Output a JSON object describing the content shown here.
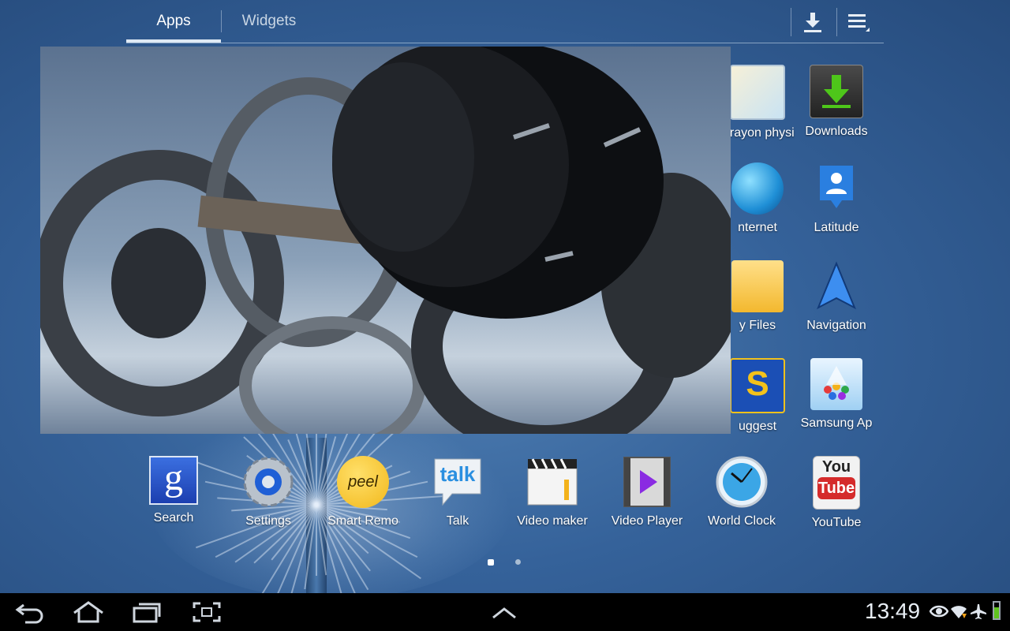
{
  "tabs": [
    {
      "label": "Apps",
      "active": true
    },
    {
      "label": "Widgets",
      "active": false
    }
  ],
  "top_actions": {
    "download": "download-icon",
    "menu": "menu-icon"
  },
  "apps_grid_right": [
    {
      "label": "Crayon physi",
      "icon": "crayon-physics-icon"
    },
    {
      "label": "Downloads",
      "icon": "downloads-icon"
    },
    {
      "label": "nternet",
      "icon": "internet-globe-icon"
    },
    {
      "label": "Latitude",
      "icon": "latitude-icon"
    },
    {
      "label": "y Files",
      "icon": "folder-icon"
    },
    {
      "label": "Navigation",
      "icon": "navigation-icon"
    },
    {
      "label": "uggest",
      "icon": "suggest-icon"
    },
    {
      "label": "Samsung Ap",
      "icon": "samsung-apps-icon"
    }
  ],
  "apps_bottom_row": [
    {
      "label": "Search",
      "icon": "google-search-icon"
    },
    {
      "label": "Settings",
      "icon": "settings-icon"
    },
    {
      "label": "Smart Remo",
      "icon": "peel-icon"
    },
    {
      "label": "Talk",
      "icon": "talk-icon"
    },
    {
      "label": "Video maker",
      "icon": "video-maker-icon"
    },
    {
      "label": "Video Player",
      "icon": "video-player-icon"
    },
    {
      "label": "World Clock",
      "icon": "world-clock-icon"
    },
    {
      "label": "YouTube",
      "icon": "youtube-icon"
    }
  ],
  "page_indicator": {
    "current": 1,
    "total": 2
  },
  "status_bar": {
    "time": "13:49",
    "icons": [
      "eye-icon",
      "wifi-icon",
      "airplane-icon",
      "battery-icon"
    ]
  },
  "nav_buttons": [
    "back-icon",
    "home-icon",
    "recent-apps-icon",
    "screenshot-icon",
    "up-arrow-icon"
  ],
  "colors": {
    "battery": "#5fc21f",
    "download_green": "#4ec61a"
  },
  "icon_text": {
    "google": "g",
    "peel": "peel",
    "talk": "talk",
    "youtube_top": "You",
    "youtube_bottom": "Tube",
    "suggest": "S"
  }
}
